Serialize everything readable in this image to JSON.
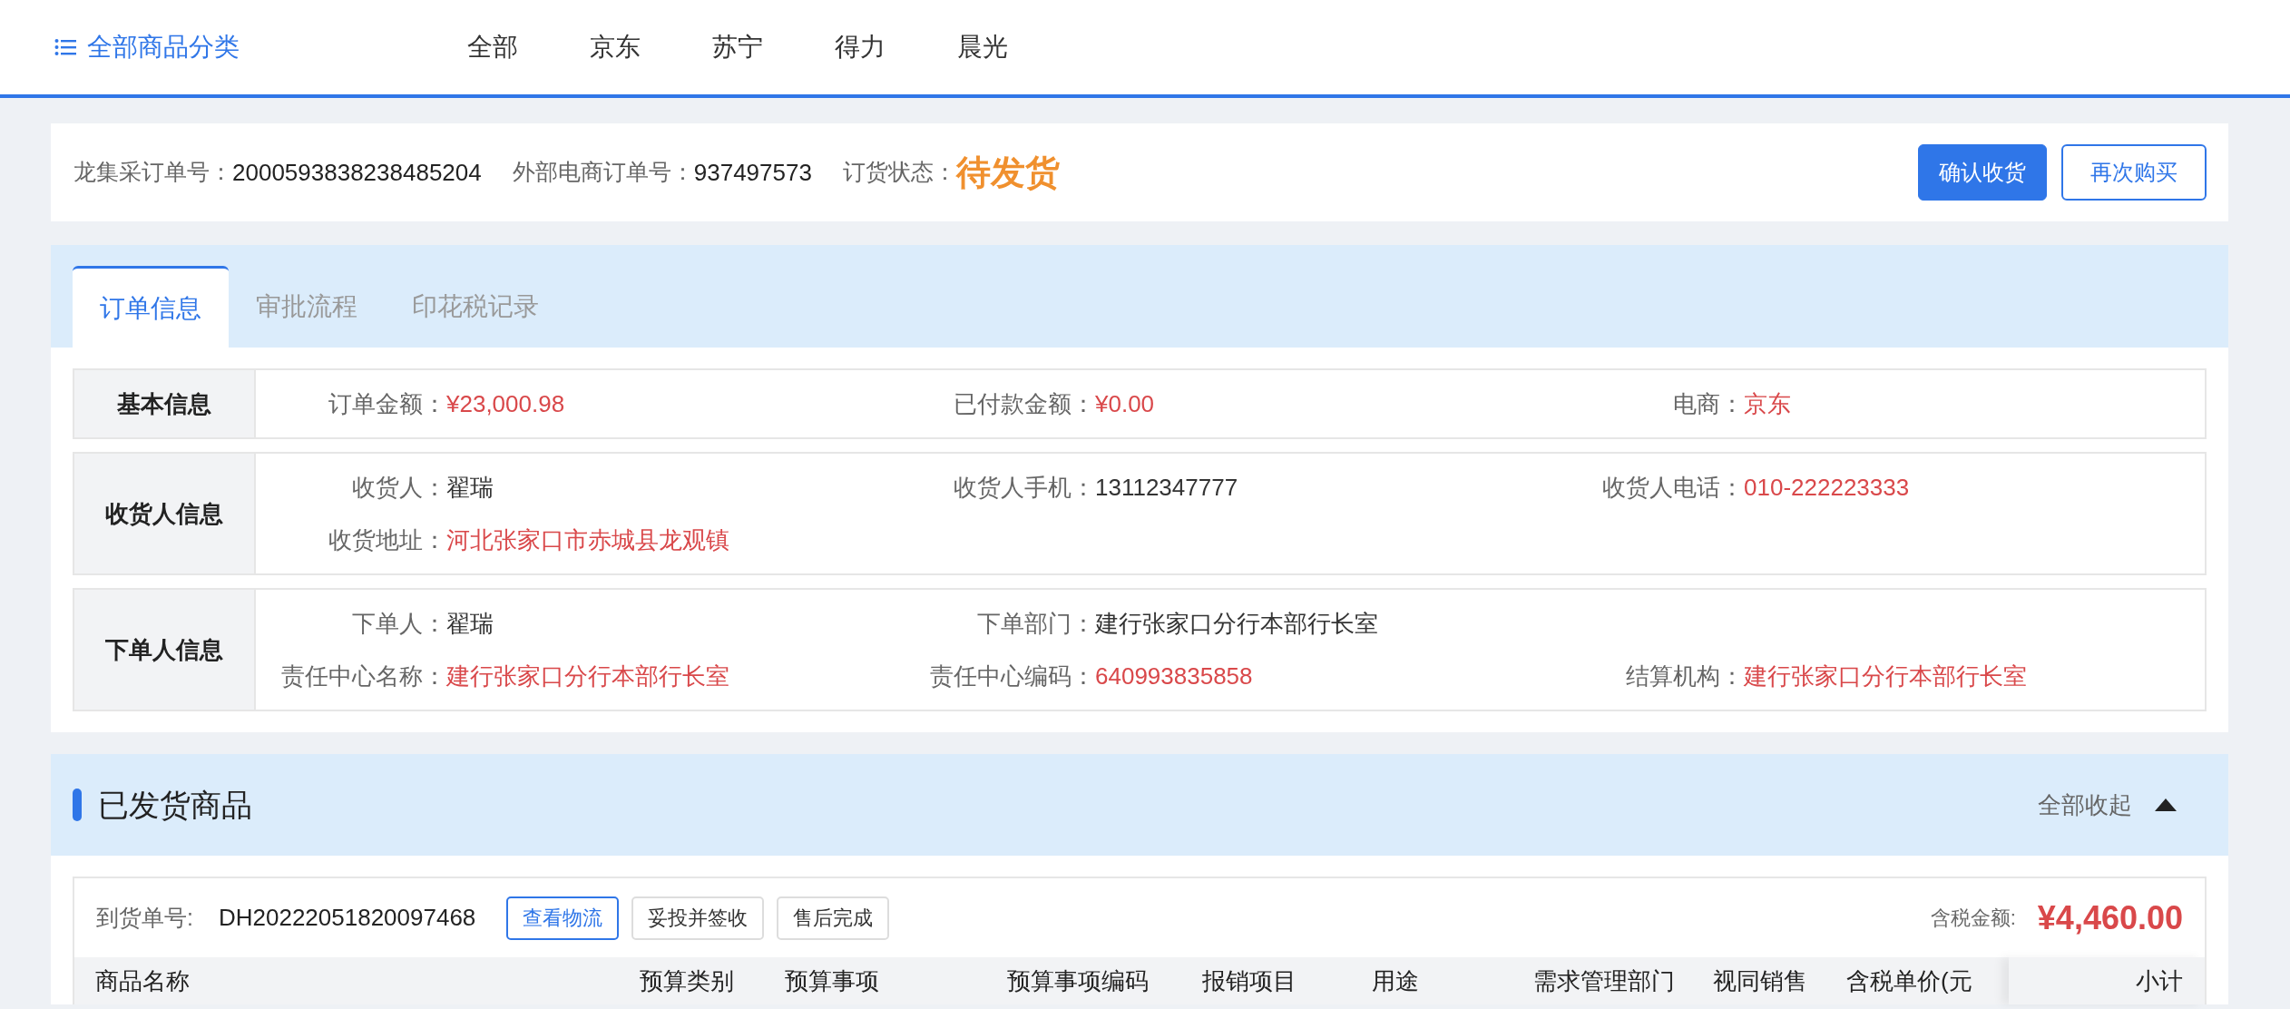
{
  "top_nav": {
    "category_link": "全部商品分类",
    "items": [
      "全部",
      "京东",
      "苏宁",
      "得力",
      "晨光"
    ]
  },
  "order_header": {
    "fields": [
      {
        "label": "龙集采订单号：",
        "value": "2000593838238485204",
        "kind": "plain"
      },
      {
        "label": "外部电商订单号：",
        "value": "937497573",
        "kind": "plain"
      },
      {
        "label": "订货状态：",
        "value": "待发货",
        "kind": "status"
      }
    ],
    "buttons": [
      {
        "label": "确认收货",
        "kind": "primary"
      },
      {
        "label": "再次购买",
        "kind": "outline"
      }
    ]
  },
  "tabs": [
    {
      "label": "订单信息",
      "selected": true
    },
    {
      "label": "审批流程",
      "selected": false
    },
    {
      "label": "印花税记录",
      "selected": false
    }
  ],
  "info_sections": [
    {
      "title": "基本信息",
      "rows": [
        [
          {
            "label": "订单金额：",
            "value": "¥23,000.98",
            "highlight": true
          },
          {
            "label": "已付款金额：",
            "value": "¥0.00",
            "highlight": true
          },
          {
            "label": "电商：",
            "value": "京东",
            "highlight": true
          }
        ]
      ]
    },
    {
      "title": "收货人信息",
      "rows": [
        [
          {
            "label": "收货人：",
            "value": "翟瑞",
            "highlight": false
          },
          {
            "label": "收货人手机：",
            "value": "13112347777",
            "highlight": false
          },
          {
            "label": "收货人电话：",
            "value": "010-222223333",
            "highlight": true
          }
        ],
        [
          {
            "label": "收货地址：",
            "value": "河北张家口市赤城县龙观镇",
            "highlight": true
          }
        ]
      ]
    },
    {
      "title": "下单人信息",
      "rows": [
        [
          {
            "label": "下单人：",
            "value": "翟瑞",
            "highlight": false
          },
          {
            "label": "下单部门：",
            "value": "建行张家口分行本部行长室",
            "highlight": false
          }
        ],
        [
          {
            "label": "责任中心名称：",
            "value": "建行张家口分行本部行长室",
            "highlight": true
          },
          {
            "label": "责任中心编码：",
            "value": "640993835858",
            "highlight": true
          },
          {
            "label": "结算机构：",
            "value": "建行张家口分行本部行长室",
            "highlight": true
          }
        ]
      ]
    }
  ],
  "shipped_section": {
    "title": "已发货商品",
    "toggle": "全部收起",
    "shipments": [
      {
        "number_label": "到货单号:",
        "number": "DH20222051820097468",
        "actions": [
          {
            "label": "查看物流",
            "kind": "primary"
          },
          {
            "label": "妥投并签收",
            "kind": "default"
          },
          {
            "label": "售后完成",
            "kind": "default"
          }
        ],
        "total_label": "含税金额:",
        "total": "¥4,460.00",
        "columns": [
          "商品名称",
          "预算类别",
          "预算事项",
          "预算事项编码",
          "报销项目",
          "用途",
          "需求管理部门",
          "视同销售",
          "含税单价(元"
        ],
        "pinned_column": "小计"
      }
    ]
  }
}
